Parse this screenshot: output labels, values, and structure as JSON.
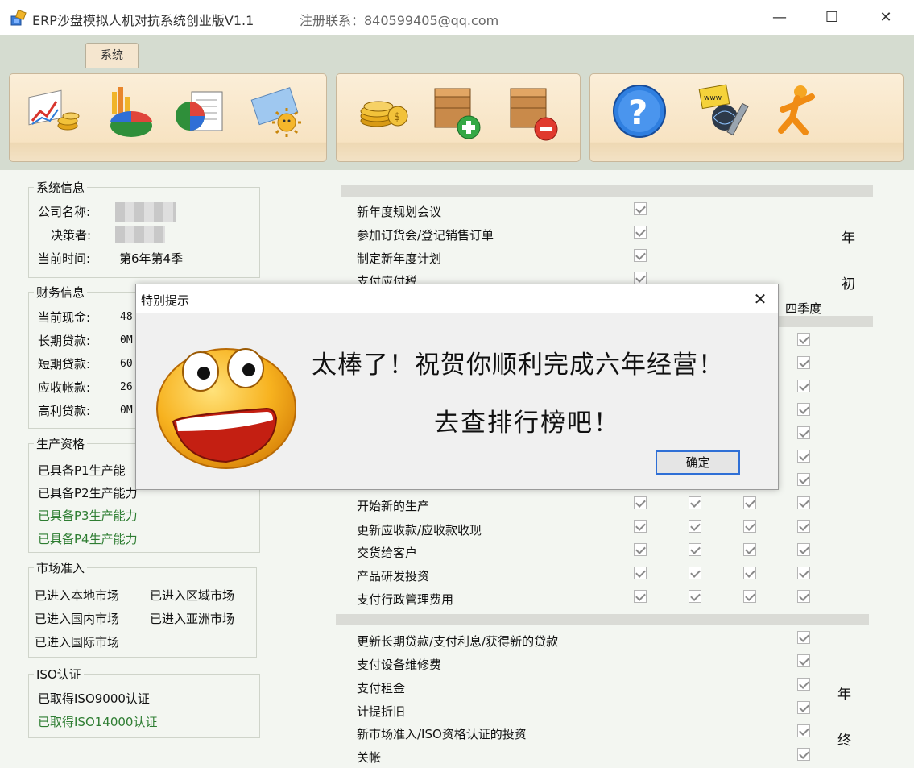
{
  "window": {
    "title": "ERP沙盘模拟人机对抗系统创业版V1.1",
    "register": "注册联系：840599405@qq.com",
    "min": "—",
    "max": "☐",
    "close": "✕"
  },
  "ribbon": {
    "tab": "系统",
    "tools_group1": [
      "chart-coins-icon",
      "bar-pie-chart-icon",
      "pie-report-icon",
      "sun-folder-icon"
    ],
    "tools_group2": [
      "gold-coins-icon",
      "crate-add-icon",
      "crate-remove-icon"
    ],
    "tools_group3": [
      "help-icon",
      "web-certificate-icon",
      "running-person-icon"
    ]
  },
  "system_info": {
    "legend": "系统信息",
    "company_label": "公司名称:",
    "decider_label": "决策者:",
    "time_label": "当前时间:",
    "time_value": "第6年第4季"
  },
  "finance": {
    "legend": "财务信息",
    "rows": [
      {
        "label": "当前现金:",
        "value": "48"
      },
      {
        "label": "长期贷款:",
        "value": "0M"
      },
      {
        "label": "短期贷款:",
        "value": "60"
      },
      {
        "label": "应收帐款:",
        "value": "26"
      },
      {
        "label": "高利贷款:",
        "value": "0M"
      }
    ]
  },
  "production": {
    "legend": "生产资格",
    "items": [
      "已具备P1生产能",
      "已具备P2生产能力",
      "已具备P3生产能力",
      "已具备P4生产能力"
    ]
  },
  "market": {
    "legend": "市场准入",
    "items": [
      "已进入本地市场",
      "已进入区域市场",
      "已进入国内市场",
      "已进入亚洲市场",
      "已进入国际市场"
    ]
  },
  "iso": {
    "legend": "ISO认证",
    "items": [
      "已取得ISO9000认证",
      "已取得ISO14000认证"
    ]
  },
  "tasks": {
    "top": [
      "新年度规划会议",
      "参加订货会/登记销售订单",
      "制定新年度计划",
      "支付应付税"
    ],
    "middle": [
      "开始新的生产",
      "更新应收款/应收款收现",
      "交货给客户",
      "产品研发投资",
      "支付行政管理费用"
    ],
    "bottom": [
      "更新长期贷款/支付利息/获得新的贷款",
      "支付设备维修费",
      "支付租金",
      "计提折旧",
      "新市场准入/ISO资格认证的投资",
      "关帐"
    ],
    "quarter_header": "四季度",
    "side_top": [
      "年",
      "初"
    ],
    "side_bottom": [
      "年",
      "终"
    ]
  },
  "dialog": {
    "title": "特别提示",
    "close": "✕",
    "message1": "太棒了！祝贺你顺利完成六年经营！",
    "message2": "去查排行榜吧！",
    "ok": "确定"
  }
}
